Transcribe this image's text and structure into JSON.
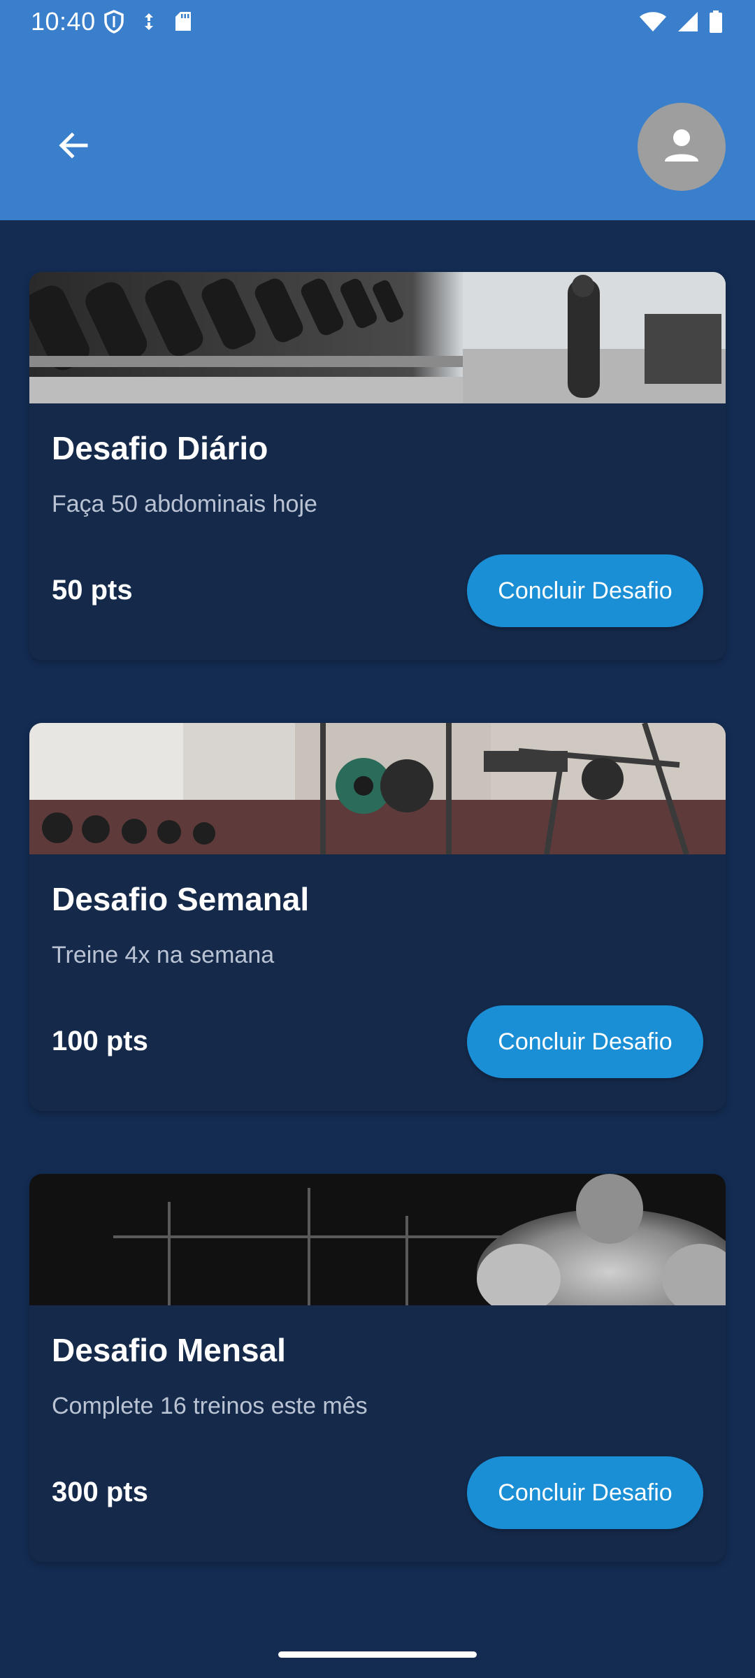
{
  "status_bar": {
    "time": "10:40",
    "left_icons": [
      "shield-icon",
      "data-saver-icon",
      "sd-card-icon"
    ],
    "right_icons": [
      "wifi-icon",
      "signal-icon",
      "battery-icon"
    ]
  },
  "app_bar": {
    "back_icon": "arrow-left-icon",
    "avatar_icon": "person-icon",
    "color": "#3a7fcb"
  },
  "challenges": [
    {
      "title": "Desafio Diário",
      "description": "Faça 50 abdominais hoje",
      "points": "50 pts",
      "button_label": "Concluir Desafio",
      "image": "gym-dumbbell-rack-photo"
    },
    {
      "title": "Desafio Semanal",
      "description": "Treine 4x na semana",
      "points": "100 pts",
      "button_label": "Concluir Desafio",
      "image": "gym-weight-plates-photo"
    },
    {
      "title": "Desafio Mensal",
      "description": "Complete 16 treinos este mês",
      "points": "300 pts",
      "button_label": "Concluir Desafio",
      "image": "bodybuilder-dark-gym-photo"
    }
  ],
  "colors": {
    "background": "#142c52",
    "card": "#15294a",
    "button": "#1b8fd6",
    "description_text": "#b9c3d3"
  }
}
